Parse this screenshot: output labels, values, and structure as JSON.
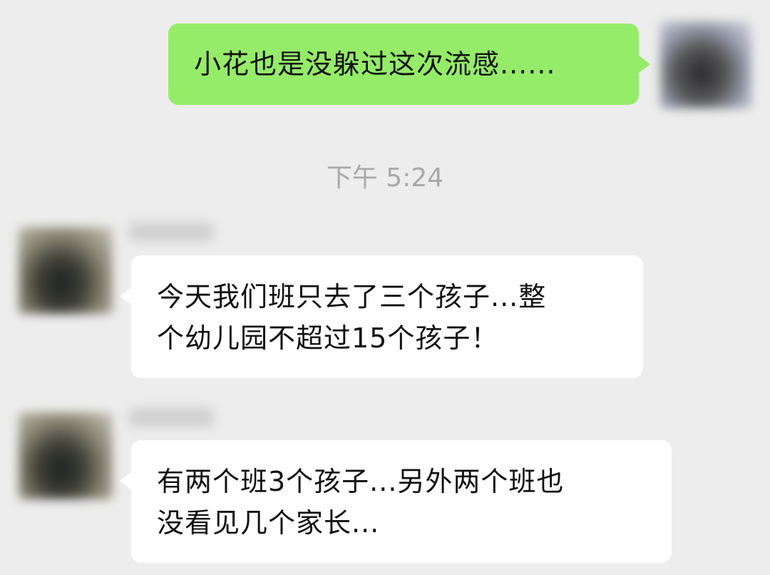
{
  "messages": [
    {
      "direction": "outgoing",
      "lines": [
        "小花也是没躲过这次流感......"
      ]
    },
    {
      "direction": "incoming",
      "lines": [
        "今天我们班只去了三个孩子...整",
        "个幼儿园不超过15个孩子！"
      ]
    },
    {
      "direction": "incoming",
      "lines": [
        "有两个班3个孩子...另外两个班也",
        "没看见几个家长..."
      ]
    }
  ],
  "timestamp": "下午 5:24",
  "colors": {
    "background": "#ededed",
    "outgoing_bubble": "#95ec69",
    "incoming_bubble": "#ffffff",
    "timestamp_text": "#a9a9a9"
  }
}
